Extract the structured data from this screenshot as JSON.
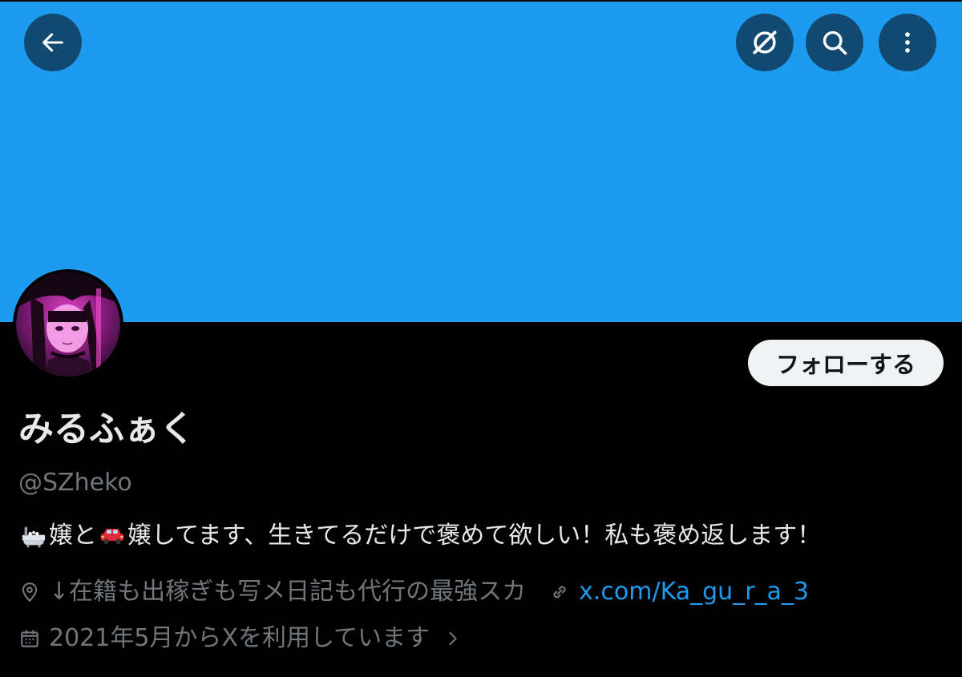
{
  "header": {
    "banner_color": "#1d9bf0",
    "back_icon": "arrow-left-icon",
    "grok_icon": "grok-icon",
    "search_icon": "search-icon",
    "more_icon": "more-vertical-icon"
  },
  "profile": {
    "display_name": "みるふぁく",
    "handle": "@SZheko",
    "follow_label": "フォローする",
    "bio": {
      "emoji1": "bathtub-icon",
      "part1": "嬢と",
      "emoji2": "car-icon",
      "part2": "嬢してます、生きてるだけで褒めて欲しい！私も褒め返します！"
    },
    "location": "↓在籍も出稼ぎも写メ日記も代行の最強スカ",
    "website": "x.com/Ka_gu_r_a_3",
    "joined": "2021年5月からXを利用しています"
  },
  "colors": {
    "accent": "#1d9bf0",
    "text_primary": "#e7e9ea",
    "text_secondary": "#71767b",
    "background": "#000000"
  }
}
